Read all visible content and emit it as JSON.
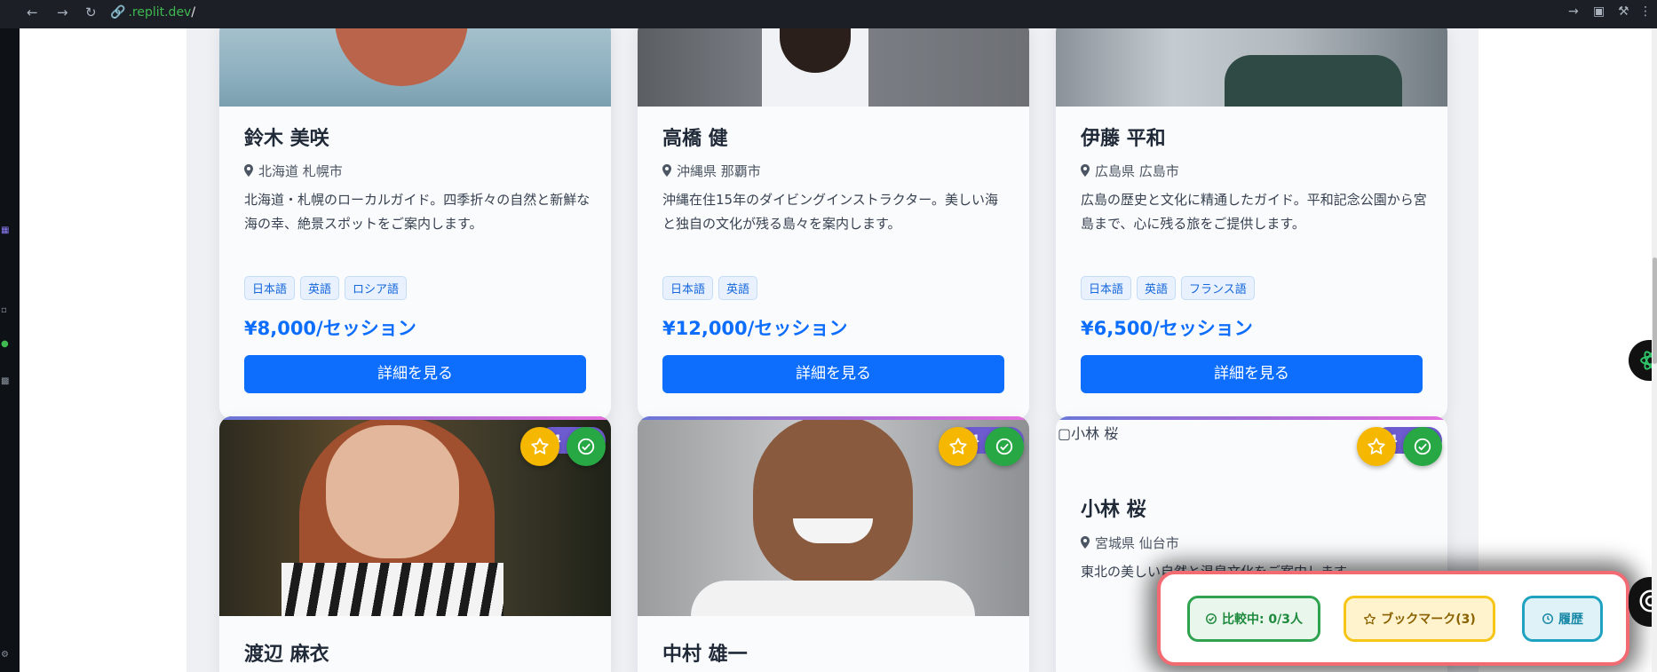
{
  "browser": {
    "url_host": ".replit.dev",
    "url_path": "/"
  },
  "guides": [
    {
      "name": "鈴木 美咲",
      "location": "北海道 札幌市",
      "description": "北海道・札幌のローカルガイド。四季折々の自然と新鮮な海の幸、絶景スポットをご案内します。",
      "languages": [
        "日本語",
        "英語",
        "ロシア語"
      ],
      "price": "¥8,000/セッション",
      "button": "詳細を見る"
    },
    {
      "name": "高橋 健",
      "location": "沖縄県 那覇市",
      "description": "沖縄在住15年のダイビングインストラクター。美しい海と独自の文化が残る島々を案内します。",
      "languages": [
        "日本語",
        "英語"
      ],
      "price": "¥12,000/セッション",
      "button": "詳細を見る"
    },
    {
      "name": "伊藤 平和",
      "location": "広島県 広島市",
      "description": "広島の歴史と文化に精通したガイド。平和記念公園から宮島まで、心に残る旅をご提供します。",
      "languages": [
        "日本語",
        "英語",
        "フランス語"
      ],
      "price": "¥6,500/セッション",
      "button": "詳細を見る"
    },
    {
      "name": "渡辺 麻衣",
      "rating": "4"
    },
    {
      "name": "中村 雄一",
      "rating": "4"
    },
    {
      "name": "小林 桜",
      "image_alt": "小林 桜",
      "location": "宮城県 仙台市",
      "description": "東北の美しい自然と温泉文化をご案内します。",
      "rating": "4"
    }
  ],
  "action_bar": {
    "compare_label": "比較中: 0/3人",
    "bookmark_label": "ブックマーク(3)",
    "history_label": "履歴"
  },
  "colors": {
    "primary": "#0d6efd",
    "compare": "#2fa24f",
    "bookmark": "#f5c518",
    "history": "#1ea2c0",
    "action_bar_border": "#f26b73"
  }
}
